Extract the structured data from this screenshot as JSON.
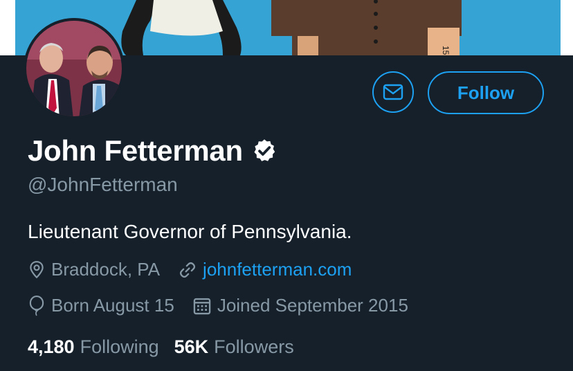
{
  "profile": {
    "name": "John Fetterman",
    "handle": "@JohnFetterman",
    "bio": "Lieutenant Governor of Pennsylvania.",
    "location": "Braddock, PA",
    "website": "johnfetterman.com",
    "birthday": "Born August 15",
    "joined": "Joined September 2015"
  },
  "actions": {
    "follow_label": "Follow"
  },
  "stats": {
    "following_count": "4,180",
    "following_label": "Following",
    "followers_count": "56K",
    "followers_label": "Followers"
  },
  "banner": {
    "figure_text": "15"
  },
  "icons": {
    "message": "envelope-icon",
    "verified": "verified-badge-icon",
    "location": "map-pin-icon",
    "link": "link-icon",
    "birthday": "balloon-icon",
    "joined": "calendar-icon"
  },
  "colors": {
    "background": "#15202b",
    "accent": "#1da1f2",
    "secondary_text": "#8899a6",
    "banner": "#35a3d3"
  }
}
